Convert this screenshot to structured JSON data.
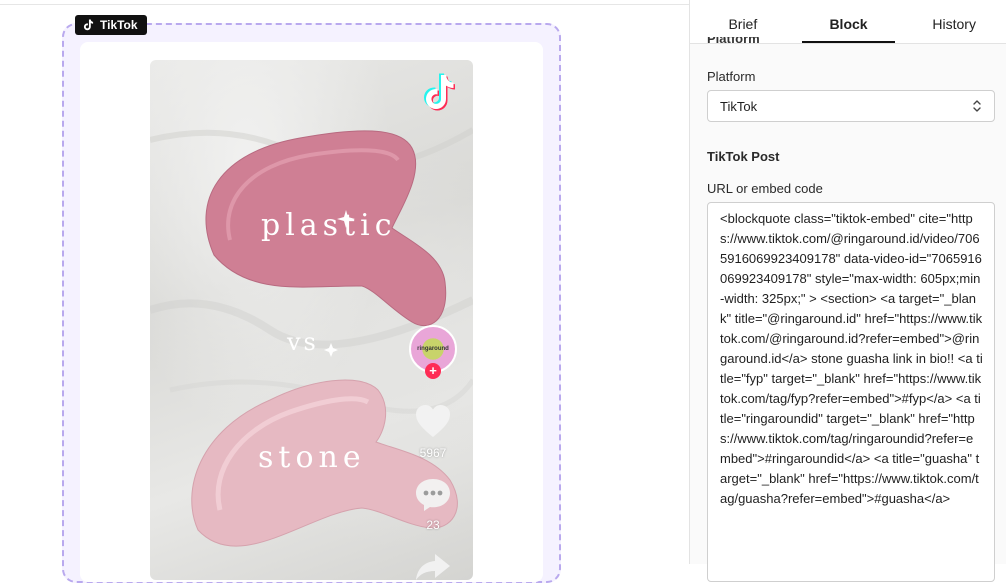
{
  "block": {
    "tag_label": "TikTok",
    "tag_icon": "tiktok-icon"
  },
  "video": {
    "overlay_text": {
      "top": "plastic",
      "middle": "vs",
      "bottom": "stone"
    },
    "logo_icon": "tiktok-logo-icon",
    "avatar_text": "ringaround",
    "follow_symbol": "+",
    "likes_count": "5967",
    "comments_count": "23",
    "colors": {
      "plastic_guasha": "#cf7f94",
      "stone_guasha": "#e6b9c2",
      "tiktok_cyan": "#25f4ee",
      "tiktok_red": "#fe2c55"
    }
  },
  "panel": {
    "tabs": [
      {
        "label": "Brief"
      },
      {
        "label": "Block"
      },
      {
        "label": "History"
      }
    ],
    "active_tab": "Block",
    "cut_heading": "Platform",
    "platform_label": "Platform",
    "platform_value": "TikTok",
    "post_heading": "TikTok Post",
    "url_label": "URL or embed code",
    "embed_code": "<blockquote class=\"tiktok-embed\" cite=\"https://www.tiktok.com/@ringaround.id/video/7065916069923409178\" data-video-id=\"7065916069923409178\" style=\"max-width: 605px;min-width: 325px;\" > <section> <a target=\"_blank\" title=\"@ringaround.id\" href=\"https://www.tiktok.com/@ringaround.id?refer=embed\">@ringaround.id</a> stone guasha link in bio!! <a title=\"fyp\" target=\"_blank\" href=\"https://www.tiktok.com/tag/fyp?refer=embed\">#fyp</a> <a title=\"ringaroundid\" target=\"_blank\" href=\"https://www.tiktok.com/tag/ringaroundid?refer=embed\">#ringaroundid</a> <a title=\"guasha\" target=\"_blank\" href=\"https://www.tiktok.com/tag/guasha?refer=embed\">#guasha</a>"
  }
}
